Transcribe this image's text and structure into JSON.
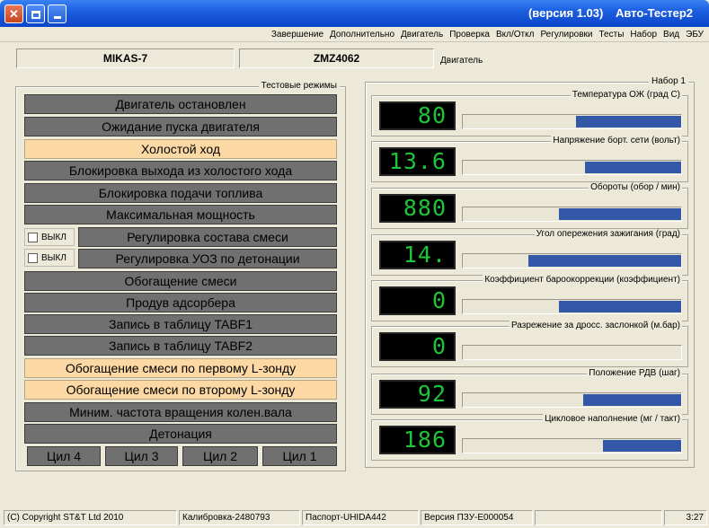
{
  "window": {
    "app_title": "Авто-Тестер2",
    "version": "(версия 1.03)"
  },
  "menu": [
    "Завершение",
    "Дополнительно",
    "Двигатель",
    "Проверка",
    "Вкл/Откл",
    "Регулировки",
    "Тесты",
    "Набор",
    "Вид",
    "ЭБУ"
  ],
  "engine": {
    "label": "Двигатель",
    "model": "ZMZ4062",
    "ecu": "MIKAS-7"
  },
  "modes": {
    "title": "Тестовые режимы",
    "buttons": [
      {
        "label": "Двигатель остановлен",
        "active": false
      },
      {
        "label": "Ожидание пуска двигателя",
        "active": false
      },
      {
        "label": "Холостой ход",
        "active": true
      },
      {
        "label": "Блокировка выхода из холостого хода",
        "active": false
      },
      {
        "label": "Блокировка подачи топлива",
        "active": false
      },
      {
        "label": "Максимальная мощность",
        "active": false
      },
      {
        "label": "Регулировка состава смеси",
        "active": false
      },
      {
        "label": "Регулировка УОЗ по детонации",
        "active": false
      },
      {
        "label": "Обогащение смеси",
        "active": false
      },
      {
        "label": "Продув адсорбера",
        "active": false
      },
      {
        "label": "Запись в таблицу TABF1",
        "active": false
      },
      {
        "label": "Запись в таблицу TABF2",
        "active": false
      },
      {
        "label": "Обогащение смеси по первому L-зонду",
        "active": true
      },
      {
        "label": "Обогащение смеси по второму L-зонду",
        "active": true
      },
      {
        "label": "Миним. частота вращения колен.вала",
        "active": false
      },
      {
        "label": "Детонация",
        "active": false
      }
    ],
    "checkbox_label": "ВЫКЛ",
    "cylinders": [
      "Цил 1",
      "Цил 2",
      "Цил 3",
      "Цил 4"
    ]
  },
  "sensors": {
    "title": "Набор 1",
    "items": [
      {
        "label": "Температура ОЖ (град С)",
        "value": "80",
        "level": 0.48
      },
      {
        "label": "Напряжение борт. сети (вольт)",
        "value": "13.6",
        "level": 0.44
      },
      {
        "label": "Обороты (обор / мин)",
        "value": "880",
        "level": 0.56
      },
      {
        "label": "Угол опережения зажигания (град)",
        "value": "14.",
        "level": 0.7
      },
      {
        "label": "Коэффициент бароокоррекции (коэффициент)",
        "value": "0",
        "level": 0.56
      },
      {
        "label": "Разрежение за дросс. заслонкой (м.бар)",
        "value": "0",
        "level": 0.0
      },
      {
        "label": "Положение РДВ (шаг)",
        "value": "92",
        "level": 0.45
      },
      {
        "label": "Цикловое наполнение (мг / такт)",
        "value": "186",
        "level": 0.36
      }
    ]
  },
  "status": {
    "time": "3:27",
    "version": "Версия ПЗУ-E000054",
    "passport": "Паспорт-UHIDA442",
    "calibration": "Калибровка-2480793",
    "copyright": "(C) Copyright ST&T Ltd 2010"
  },
  "colors": {
    "lcd_text": "#1ec43a",
    "mode_inactive": "#707070",
    "mode_active": "#fcd9a4",
    "bar_fill": "#3458a8"
  }
}
